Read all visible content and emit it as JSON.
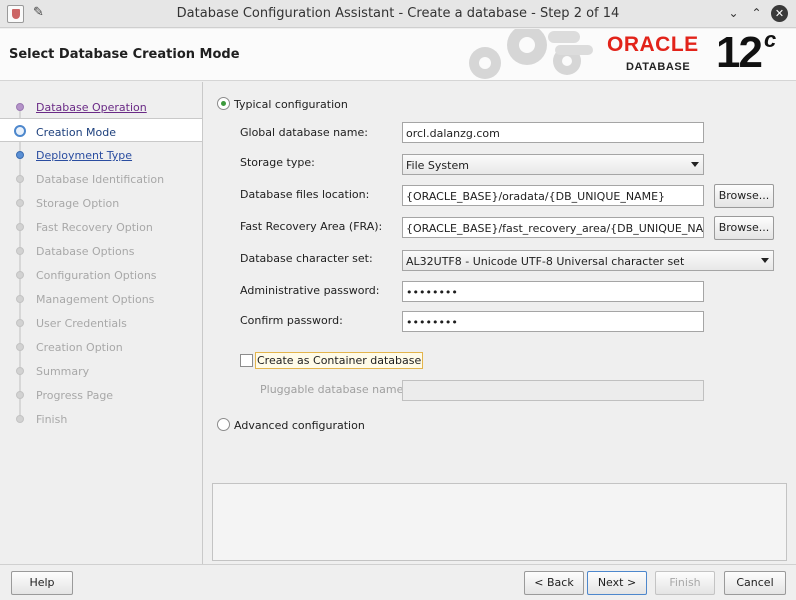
{
  "window": {
    "title": "Database Configuration Assistant - Create a database - Step 2 of 14"
  },
  "header": {
    "page_title": "Select Database Creation Mode",
    "logo_oracle": "ORACLE",
    "logo_database": "DATABASE",
    "logo_version": "12",
    "logo_version_suffix": "c"
  },
  "steps": [
    {
      "label": "Database Operation",
      "state": "done"
    },
    {
      "label": "Creation Mode",
      "state": "current"
    },
    {
      "label": "Deployment Type",
      "state": "next"
    },
    {
      "label": "Database Identification",
      "state": "pending"
    },
    {
      "label": "Storage Option",
      "state": "pending"
    },
    {
      "label": "Fast Recovery Option",
      "state": "pending"
    },
    {
      "label": "Database Options",
      "state": "pending"
    },
    {
      "label": "Configuration Options",
      "state": "pending"
    },
    {
      "label": "Management Options",
      "state": "pending"
    },
    {
      "label": "User Credentials",
      "state": "pending"
    },
    {
      "label": "Creation Option",
      "state": "pending"
    },
    {
      "label": "Summary",
      "state": "pending"
    },
    {
      "label": "Progress Page",
      "state": "pending"
    },
    {
      "label": "Finish",
      "state": "pending"
    }
  ],
  "form": {
    "typical_label": "Typical configuration",
    "typical_selected": true,
    "global_db_name_label": "Global database name:",
    "global_db_name_value": "orcl.dalanzg.com",
    "storage_type_label": "Storage type:",
    "storage_type_value": "File System",
    "db_files_location_label": "Database files location:",
    "db_files_location_value": "{ORACLE_BASE}/oradata/{DB_UNIQUE_NAME}",
    "fra_label": "Fast Recovery Area (FRA):",
    "fra_value": "{ORACLE_BASE}/fast_recovery_area/{DB_UNIQUE_NAME}",
    "browse_label": "Browse...",
    "charset_label": "Database character set:",
    "charset_value": "AL32UTF8 - Unicode UTF-8 Universal character set",
    "admin_password_label": "Administrative password:",
    "admin_password_value": "••••••••",
    "confirm_password_label": "Confirm password:",
    "confirm_password_value": "••••••••",
    "container_db_label": "Create as Container database",
    "container_db_checked": false,
    "pdb_name_label": "Pluggable database name:",
    "pdb_name_value": "",
    "advanced_label": "Advanced configuration",
    "advanced_selected": false
  },
  "footer": {
    "help": "Help",
    "back": "< Back",
    "next": "Next >",
    "finish": "Finish",
    "cancel": "Cancel"
  },
  "colors": {
    "oracle_red": "#e2231a",
    "step_done": "#6a2a86",
    "step_link": "#2a4da0",
    "radio_selected": "#3d9a3d"
  }
}
